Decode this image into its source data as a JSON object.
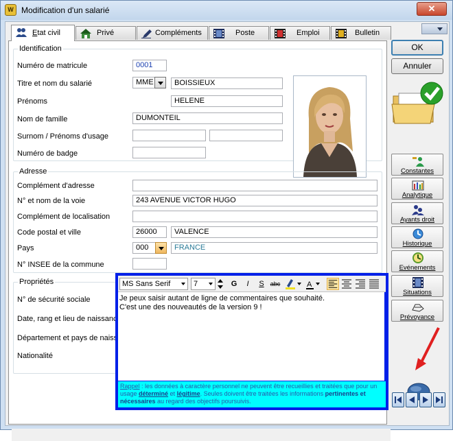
{
  "window": {
    "title": "Modification d'un salarié",
    "close_label": "✕"
  },
  "tabs": [
    {
      "label": "Etat civil",
      "accel": "E",
      "rest": "tat civil",
      "icon": "users-icon",
      "active": true
    },
    {
      "label": "Privé",
      "icon": "house-icon"
    },
    {
      "label": "Compléments",
      "icon": "pen-icon"
    },
    {
      "label": "Poste",
      "icon": "film-icon"
    },
    {
      "label": "Emploi",
      "icon": "film-red-icon"
    },
    {
      "label": "Bulletin",
      "icon": "film-yellow-icon"
    }
  ],
  "identification": {
    "legend": "Identification",
    "matricule_label": "Numéro de matricule",
    "matricule_value": "0001",
    "titre_label": "Titre et nom du salarié",
    "titre_value": "MME",
    "nom_salarie_value": "BOISSIEUX",
    "prenoms_label": "Prénoms",
    "prenoms_value": "HELENE",
    "nom_famille_label": "Nom de famille",
    "nom_famille_value": "DUMONTEIL",
    "surnom_label": "Surnom / Prénoms d'usage",
    "surnom_value": "",
    "prenoms_usage_value": "",
    "badge_label": "Numéro de badge",
    "badge_value": ""
  },
  "adresse": {
    "legend": "Adresse",
    "complement_label": "Complément d'adresse",
    "complement_value": "",
    "voie_label": "N° et nom de la voie",
    "voie_value": "243 AVENUE VICTOR HUGO",
    "localisation_label": "Complément de localisation",
    "localisation_value": "",
    "cp_ville_label": "Code postal et ville",
    "cp_value": "26000",
    "ville_value": "VALENCE",
    "pays_label": "Pays",
    "pays_code": "000",
    "pays_value": "FRANCE",
    "insee_label": "N° INSEE de la commune",
    "insee_value": ""
  },
  "proprietes": {
    "legend": "Propriétés",
    "secu_label": "N° de sécurité sociale",
    "naissance_label": "Date, rang et lieu de naissance",
    "dept_label": "Département et pays de naissance",
    "nationalite_label": "Nationalité"
  },
  "buttons": {
    "ok": "OK",
    "annuler": "Annuler"
  },
  "side_buttons": [
    {
      "label": "Constantes",
      "icon": "constantes-icon"
    },
    {
      "label": "Analytique",
      "icon": "analytique-icon"
    },
    {
      "label": "Ayants droit",
      "icon": "ayants-droit-icon"
    },
    {
      "label": "Historique",
      "icon": "historique-icon"
    },
    {
      "label": "Evénements",
      "icon": "evenements-icon"
    },
    {
      "label": "Situations",
      "icon": "situations-icon"
    },
    {
      "label": "Prévoyance",
      "icon": "prevoyance-icon"
    }
  ],
  "editor": {
    "font": "MS Sans Serif",
    "size": "7",
    "bold": "G",
    "italic": "I",
    "underline": "S",
    "strike": "abc",
    "line1": "Je peux saisir autant de ligne de commentaires que souhaité.",
    "line2": "C'est une des nouveautés de la version 9 !",
    "rappel_link": "Rappel",
    "rappel_p1": " : les données à caractère personnel ne peuvent être recueillies et traitées que pour un usage ",
    "rappel_determine": "déterminé",
    "rappel_et": " et ",
    "rappel_legitime": "légitime",
    "rappel_p2": ". Seules doivent être traitées les informations ",
    "rappel_pertinentes": "pertinentes et nécessaires",
    "rappel_p3": " au regard des objectifs poursuivis."
  },
  "colors": {
    "accent_blue": "#0020e8",
    "cyan": "#00ffff",
    "close_red": "#c8462c",
    "arrow_red": "#e02020"
  }
}
